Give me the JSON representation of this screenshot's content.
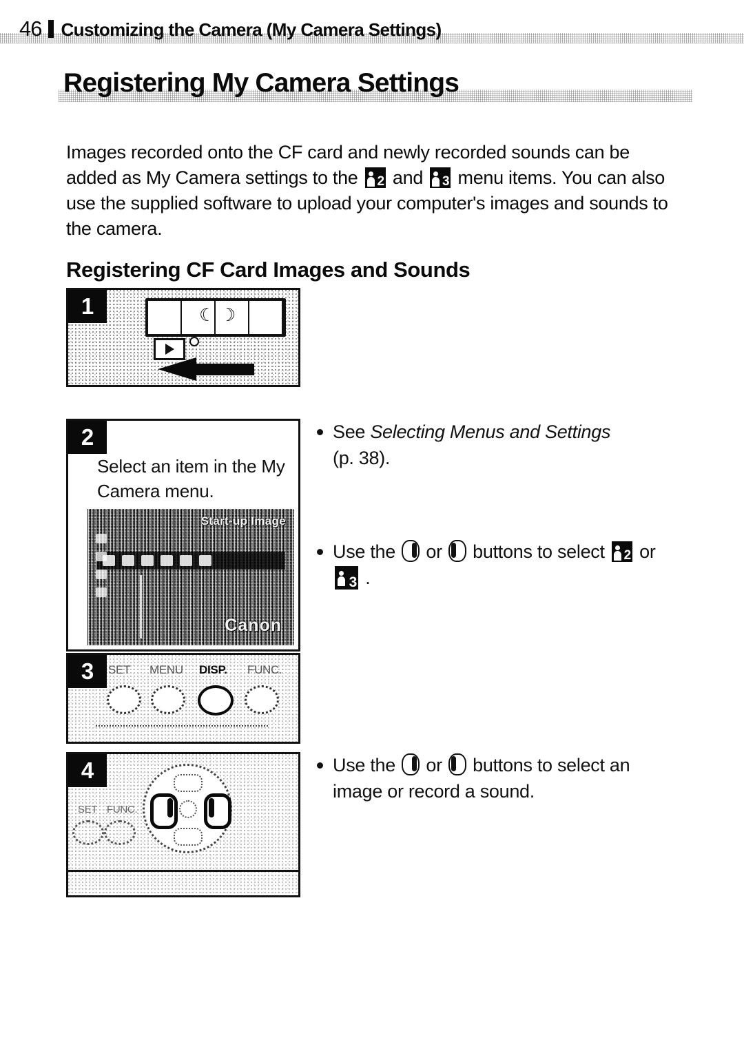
{
  "header": {
    "page_number": "46",
    "title": "Customizing the Camera (My Camera Settings)"
  },
  "main_title": "Registering My Camera Settings",
  "intro": {
    "part1": "Images recorded onto the CF card and newly recorded sounds can be added as My Camera settings to the ",
    "icon_2": "2",
    "part2": " and ",
    "icon_3": "3",
    "part3": " menu items. You can also use the supplied software to upload your computer's images and sounds to the camera."
  },
  "section_heading": "Registering CF Card Images and Sounds",
  "steps": {
    "one": {
      "badge": "1",
      "playback_icon": "playback-triangle-icon"
    },
    "two": {
      "badge": "2",
      "caption": "Select an item in the My Camera menu.",
      "lcd": {
        "title": "Start-up Image",
        "brand": "Canon"
      }
    },
    "three": {
      "badge": "3",
      "buttons": [
        {
          "label": "SET",
          "active": false
        },
        {
          "label": "MENU",
          "active": false
        },
        {
          "label": "DISP.",
          "active": true
        },
        {
          "label": "FUNC.",
          "active": false
        }
      ]
    },
    "four": {
      "badge": "4",
      "side_labels": [
        "SET",
        "FUNC."
      ]
    }
  },
  "bullets": {
    "see_menus": {
      "lead": "See ",
      "italic_title": "Selecting Menus and Settings",
      "page_ref": "(p. 38)."
    },
    "use_buttons_select": {
      "part1": "Use the ",
      "or": " or ",
      "part2": " buttons to select ",
      "icon_a": "2",
      "part3": " or ",
      "icon_b": "3",
      "part4": " ."
    },
    "use_buttons_image": {
      "part1": "Use the ",
      "or": " or ",
      "part2": " buttons to select an image or record a sound."
    }
  },
  "colors": {
    "ink": "#0a0a0a",
    "paper": "#ffffff",
    "lcd_gray": "#8d8d8d"
  }
}
